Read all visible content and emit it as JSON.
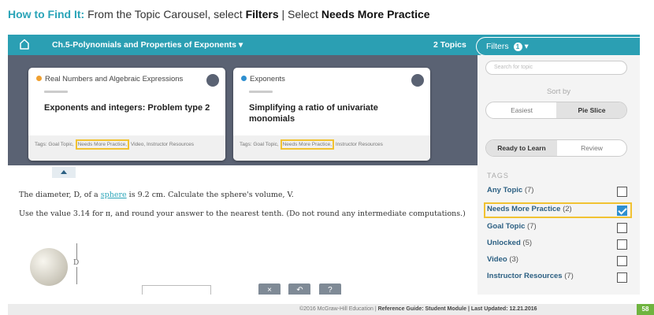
{
  "headline": {
    "lead": "How to Find It:",
    "part1": "From the Topic Carousel, select",
    "filters": "Filters",
    "sep": "|",
    "part2": "Select",
    "needs": "Needs More Practice"
  },
  "topbar": {
    "title": "Ch.5-Polynomials and Properties of Exponents",
    "topics": "2 Topics",
    "filters_label": "Filters",
    "filters_count": "1"
  },
  "cards": [
    {
      "category": "Real Numbers and Algebraic Expressions",
      "dot_color": "#f0a030",
      "title": "Exponents and integers: Problem type 2",
      "tags_prefix": "Tags: Goal Topic,",
      "tags_highlight": "Needs More Practice,",
      "tags_suffix": "Video, Instructor Resources"
    },
    {
      "category": "Exponents",
      "dot_color": "#2e8fd0",
      "title": "Simplifying a ratio of univariate monomials",
      "tags_prefix": "Tags: Goal Topic,",
      "tags_highlight": "Needs More Practice,",
      "tags_suffix": "Instructor Resources"
    }
  ],
  "question": {
    "line1_a": "The diameter, D, of a",
    "line1_link": "sphere",
    "line1_b": "is 9.2 cm. Calculate the sphere's volume, V.",
    "line2": "Use the value 3.14 for π, and round your answer to the nearest tenth. (Do not round any intermediate computations.)",
    "diagram_label": "D"
  },
  "tools": [
    "×",
    "↶",
    "?"
  ],
  "panel": {
    "search_placeholder": "Search for topic",
    "sort_by": "Sort by",
    "sort_options": [
      "Easiest",
      "Pie Slice"
    ],
    "status_options": [
      "Ready to Learn",
      "Review"
    ],
    "tags_heading": "TAGS",
    "filters": [
      {
        "label": "Any Topic",
        "count": "(7)",
        "checked": false
      },
      {
        "label": "Needs More Practice",
        "count": "(2)",
        "checked": true
      },
      {
        "label": "Goal Topic",
        "count": "(7)",
        "checked": false
      },
      {
        "label": "Unlocked",
        "count": "(5)",
        "checked": false
      },
      {
        "label": "Video",
        "count": "(3)",
        "checked": false
      },
      {
        "label": "Instructor Resources",
        "count": "(7)",
        "checked": false
      }
    ]
  },
  "footer": {
    "copyright": "©2016 McGraw-Hill Education",
    "sep": "|",
    "guide": "Reference Guide: Student Module | Last Updated: 12.21.2016",
    "page": "58"
  },
  "colors": {
    "accent": "#2b9fb3",
    "highlight": "#f1c232",
    "check": "#2e8fd0"
  }
}
